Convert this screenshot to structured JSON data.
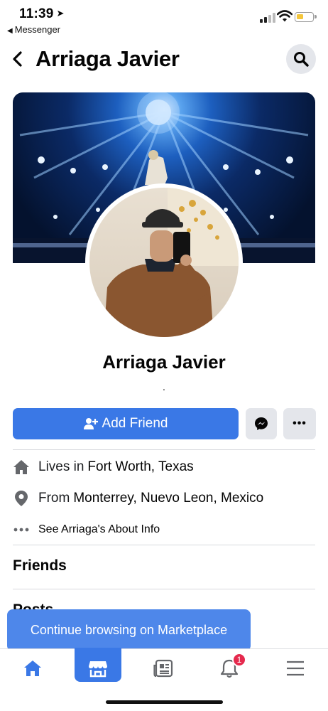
{
  "status_bar": {
    "time": "11:39",
    "back_app": "Messenger"
  },
  "header": {
    "title": "Arriaga Javier"
  },
  "profile": {
    "name": "Arriaga Javier",
    "subtitle": "."
  },
  "actions": {
    "add_friend": "Add Friend",
    "more": "•••"
  },
  "info": {
    "lives_prefix": "Lives in",
    "lives_place": "Fort Worth, Texas",
    "from_prefix": "From",
    "from_place": "Monterrey, Nuevo Leon, Mexico",
    "about_link": "See Arriaga's About Info"
  },
  "sections": {
    "friends": "Friends",
    "posts": "Posts"
  },
  "toast": "Continue browsing on Marketplace",
  "tabbar": {
    "items": [
      "home-icon",
      "marketplace-icon",
      "news-icon",
      "notifications-icon",
      "menu-icon"
    ],
    "active": "marketplace-icon",
    "notification_count": "1"
  },
  "colors": {
    "accent": "#3a78e6",
    "badge": "#e5294d",
    "toast": "#4e87ea"
  }
}
